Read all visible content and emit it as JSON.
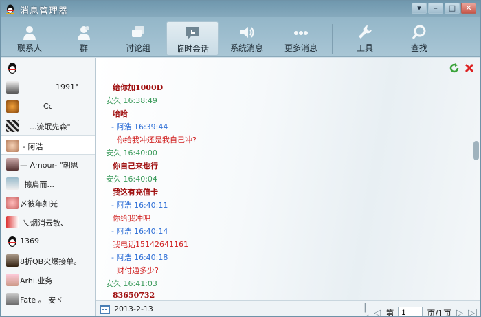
{
  "window": {
    "title": "消息管理器",
    "buttons": [
      "▾",
      "–",
      "□",
      "✕"
    ]
  },
  "toolbar": [
    {
      "label": "联系人",
      "icon": "person-icon"
    },
    {
      "label": "群",
      "icon": "group-icon"
    },
    {
      "label": "讨论组",
      "icon": "discussion-icon"
    },
    {
      "label": "临时会话",
      "icon": "temp-chat-icon",
      "active": true
    },
    {
      "label": "系统消息",
      "icon": "speaker-icon"
    },
    {
      "label": "更多消息",
      "icon": "more-icon"
    },
    {
      "label": "工具",
      "icon": "wrench-icon"
    },
    {
      "label": "查找",
      "icon": "search-icon"
    }
  ],
  "contacts": [
    {
      "name": ""
    },
    {
      "name": "1991°"
    },
    {
      "name": "Cc"
    },
    {
      "name": "...流氓先森\""
    },
    {
      "name": "- 阿浩",
      "active": true
    },
    {
      "name": "— Amour- \"朝思"
    },
    {
      "name": "'                  擦肩而..."
    },
    {
      "name": "〆彼年如光"
    },
    {
      "name": "乀烟消云散、"
    },
    {
      "name": "1369"
    },
    {
      "name": "8折QB火爆接单。"
    },
    {
      "name": "Arhi.业务"
    },
    {
      "name": "Fate 。    安ヾ"
    }
  ],
  "messages": [
    {
      "type": "body-bold",
      "text": "给你加1000D"
    },
    {
      "type": "sender-a",
      "text": "安久    16:38:49"
    },
    {
      "type": "body-bold",
      "text": "哈哈"
    },
    {
      "type": "sender-b",
      "text": "- 阿浩 16:39:44"
    },
    {
      "type": "body-red",
      "text": "你给我冲还是我自己冲?"
    },
    {
      "type": "sender-a",
      "text": "安久    16:40:00"
    },
    {
      "type": "body-bold",
      "text": "你自己来也行"
    },
    {
      "type": "sender-a",
      "text": "安久    16:40:04"
    },
    {
      "type": "body-bold",
      "text": "我这有充值卡"
    },
    {
      "type": "sender-b",
      "text": "- 阿浩 16:40:11"
    },
    {
      "type": "body-red",
      "text": "你给我冲吧"
    },
    {
      "type": "sender-b",
      "text": "- 阿浩 16:40:14"
    },
    {
      "type": "body-red",
      "text": "我电话15142641161"
    },
    {
      "type": "sender-b",
      "text": "- 阿浩 16:40:18"
    },
    {
      "type": "body-red",
      "text": "财付通多少?"
    },
    {
      "type": "sender-a",
      "text": "安久    16:41:03"
    },
    {
      "type": "body-bold",
      "text": "83650732"
    }
  ],
  "footer": {
    "date": "2013-2-13",
    "page_prefix": "第",
    "page_value": "1",
    "page_suffix": "页/1页",
    "nav": [
      "|◁",
      "◁",
      "▷",
      "▷|"
    ]
  },
  "colors": {
    "accent": "#8fb3c6",
    "sender_a": "#3a9a5a",
    "sender_b": "#2d6ed6",
    "body_red": "#d02020",
    "body_bold": "#a01010"
  }
}
